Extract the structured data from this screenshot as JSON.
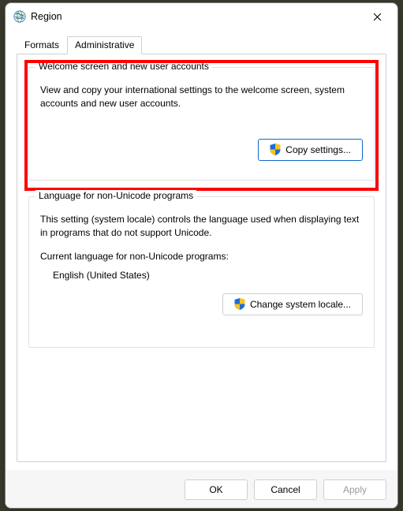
{
  "window": {
    "title": "Region"
  },
  "tabs": {
    "formats": "Formats",
    "administrative": "Administrative"
  },
  "group1": {
    "title": "Welcome screen and new user accounts",
    "body": "View and copy your international settings to the welcome screen, system accounts and new user accounts.",
    "button": "Copy settings..."
  },
  "group2": {
    "title": "Language for non-Unicode programs",
    "body": "This setting (system locale) controls the language used when displaying text in programs that do not support Unicode.",
    "current_label": "Current language for non-Unicode programs:",
    "current_value": "English (United States)",
    "button": "Change system locale..."
  },
  "footer": {
    "ok": "OK",
    "cancel": "Cancel",
    "apply": "Apply"
  }
}
